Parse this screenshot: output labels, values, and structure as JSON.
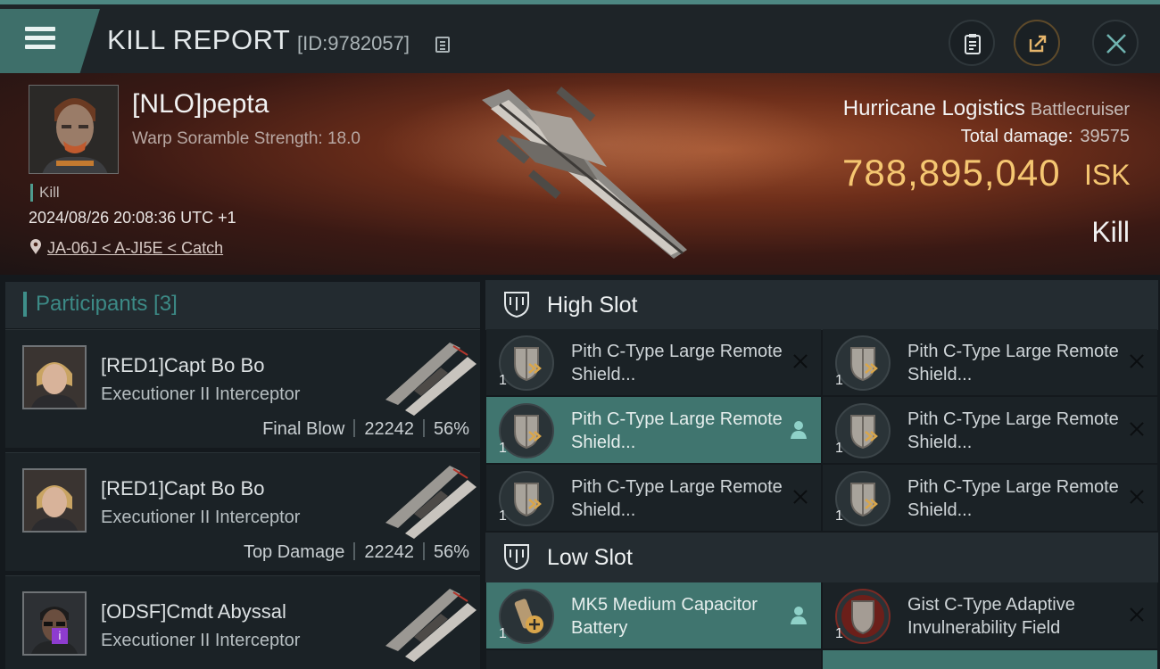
{
  "header": {
    "title": "KILL REPORT",
    "report_id": "[ID:9782057]"
  },
  "victim": {
    "name": "[NLO]pepta",
    "warp_text": "Warp Soramble Strength: 18.0",
    "tag": "Kill",
    "datetime": "2024/08/26 20:08:36 UTC +1",
    "location": "JA-06J < A-JI5E < Catch",
    "ship_name": "Hurricane Logistics",
    "ship_class": "Battlecruiser",
    "total_damage_label": "Total damage:",
    "total_damage": "39575",
    "isk_value": "788,895,040",
    "isk_unit": "ISK",
    "result": "Kill"
  },
  "participants": {
    "title": "Participants [3]",
    "items": [
      {
        "name": "[RED1]Capt Bo Bo",
        "ship": "Executioner II Interceptor",
        "role": "Final Blow",
        "damage": "22242",
        "percent": "56%"
      },
      {
        "name": "[RED1]Capt Bo Bo",
        "ship": "Executioner II Interceptor",
        "role": "Top Damage",
        "damage": "22242",
        "percent": "56%"
      },
      {
        "name": "[ODSF]Cmdt Abyssal",
        "ship": "Executioner II Interceptor",
        "badge": "i"
      }
    ]
  },
  "slots": {
    "high": {
      "title": "High Slot",
      "modules": [
        {
          "name": "Pith C-Type Large Remote Shield...",
          "qty": "1"
        },
        {
          "name": "Pith C-Type Large Remote Shield...",
          "qty": "1"
        },
        {
          "name": "Pith C-Type Large Remote Shield...",
          "qty": "1"
        },
        {
          "name": "Pith C-Type Large Remote Shield...",
          "qty": "1"
        },
        {
          "name": "Pith C-Type Large Remote Shield...",
          "qty": "1"
        },
        {
          "name": "Pith C-Type Large Remote Shield...",
          "qty": "1"
        }
      ]
    },
    "low": {
      "title": "Low Slot",
      "modules": [
        {
          "name": "MK5 Medium Capacitor Battery",
          "qty": "1"
        },
        {
          "name": "Gist C-Type Adaptive Invulnerability Field",
          "qty": "1"
        }
      ]
    }
  },
  "colors": {
    "accent": "#40756f",
    "isk": "#f5c671",
    "banner": "#6d2e1a"
  },
  "icons": [
    "menu-icon",
    "copy-icon",
    "clipboard-icon",
    "share-icon",
    "close-icon",
    "location-pin-icon",
    "slot-shield-icon",
    "remote-shield-icon",
    "capacitor-battery-icon",
    "invulnerability-field-icon",
    "user-icon"
  ]
}
